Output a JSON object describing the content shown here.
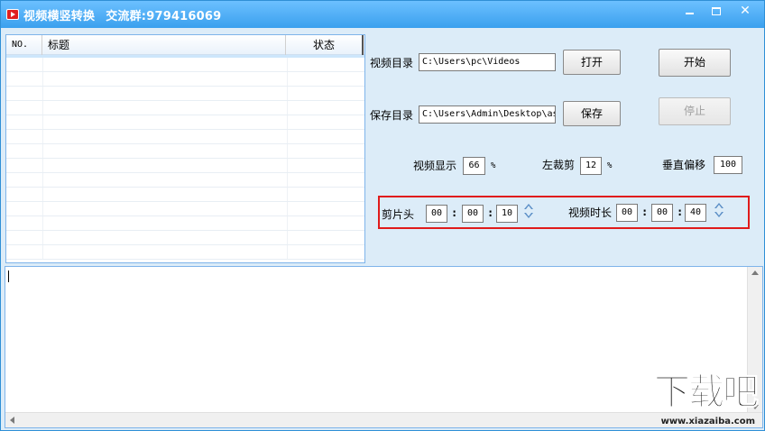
{
  "window": {
    "title": "视频横竖转换",
    "subtitle": "交流群:979416069",
    "controls": {
      "minimize": "minimize",
      "maximize": "maximize",
      "close": "✕"
    }
  },
  "file_list": {
    "columns": {
      "no": "NO.",
      "title": "标题",
      "status": "状态"
    },
    "rows": []
  },
  "settings": {
    "video_dir_label": "视频目录",
    "video_dir_value": "C:\\Users\\pc\\Videos",
    "open_label": "打开",
    "start_label": "开始",
    "save_dir_label": "保存目录",
    "save_dir_value": "C:\\Users\\Admin\\Desktop\\as",
    "save_label": "保存",
    "stop_label": "停止",
    "video_display_label": "视频显示",
    "video_display_value": "66",
    "percent_1": "%",
    "left_crop_label": "左裁剪",
    "left_crop_value": "12",
    "percent_2": "%",
    "vertical_offset_label": "垂直偏移",
    "vertical_offset_value": "100"
  },
  "timing": {
    "trim_head_label": "剪片头",
    "trim_h": "00",
    "trim_m": "00",
    "trim_s": "10",
    "duration_label": "视频时长",
    "dur_h": "00",
    "dur_m": "00",
    "dur_s": "40",
    "colon": ":"
  },
  "log": {
    "content": ""
  },
  "watermark": {
    "main": "下载吧",
    "sub": "www.xiazaiba.com"
  },
  "colors": {
    "titlebar": "#3aa0ee",
    "window_bg": "#dcecf8",
    "highlight": "#e01b1b"
  }
}
